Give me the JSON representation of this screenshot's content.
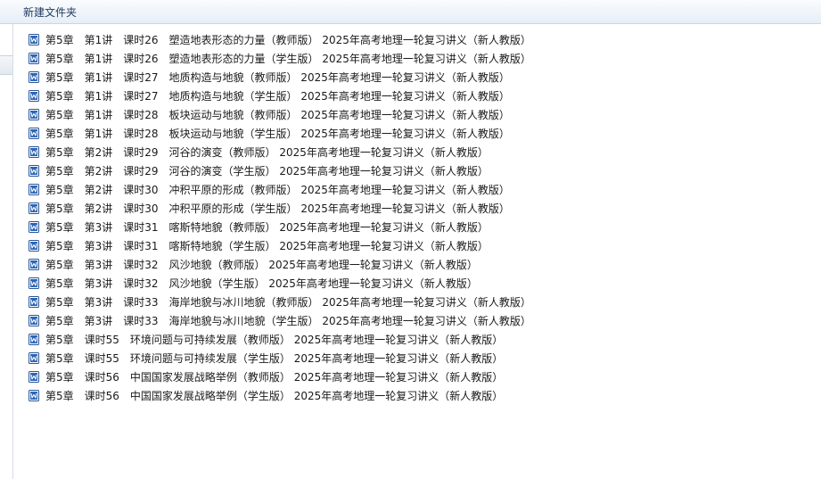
{
  "window": {
    "title": "新建文件夹"
  },
  "file_icon": "word-document-icon",
  "files": [
    "第5章　第1讲　课时26　塑造地表形态的力量（教师版） 2025年高考地理一轮复习讲义（新人教版）",
    "第5章　第1讲　课时26　塑造地表形态的力量（学生版） 2025年高考地理一轮复习讲义（新人教版）",
    "第5章　第1讲　课时27　地质构造与地貌（教师版） 2025年高考地理一轮复习讲义（新人教版）",
    "第5章　第1讲　课时27　地质构造与地貌（学生版） 2025年高考地理一轮复习讲义（新人教版）",
    "第5章　第1讲　课时28　板块运动与地貌（教师版） 2025年高考地理一轮复习讲义（新人教版）",
    "第5章　第1讲　课时28　板块运动与地貌（学生版） 2025年高考地理一轮复习讲义（新人教版）",
    "第5章　第2讲　课时29　河谷的演变（教师版） 2025年高考地理一轮复习讲义（新人教版）",
    "第5章　第2讲　课时29　河谷的演变（学生版） 2025年高考地理一轮复习讲义（新人教版）",
    "第5章　第2讲　课时30　冲积平原的形成（教师版） 2025年高考地理一轮复习讲义（新人教版）",
    "第5章　第2讲　课时30　冲积平原的形成（学生版） 2025年高考地理一轮复习讲义（新人教版）",
    "第5章　第3讲　课时31　喀斯特地貌（教师版） 2025年高考地理一轮复习讲义（新人教版）",
    "第5章　第3讲　课时31　喀斯特地貌（学生版） 2025年高考地理一轮复习讲义（新人教版）",
    "第5章　第3讲　课时32　风沙地貌（教师版） 2025年高考地理一轮复习讲义（新人教版）",
    "第5章　第3讲　课时32　风沙地貌（学生版） 2025年高考地理一轮复习讲义（新人教版）",
    "第5章　第3讲　课时33　海岸地貌与冰川地貌（教师版） 2025年高考地理一轮复习讲义（新人教版）",
    "第5章　第3讲　课时33　海岸地貌与冰川地貌（学生版） 2025年高考地理一轮复习讲义（新人教版）",
    "第5章　课时55　环境问题与可持续发展（教师版） 2025年高考地理一轮复习讲义（新人教版）",
    "第5章　课时55　环境问题与可持续发展（学生版） 2025年高考地理一轮复习讲义（新人教版）",
    "第5章　课时56　中国国家发展战略举例（教师版） 2025年高考地理一轮复习讲义（新人教版）",
    "第5章　课时56　中国国家发展战略举例（学生版） 2025年高考地理一轮复习讲义（新人教版）"
  ]
}
